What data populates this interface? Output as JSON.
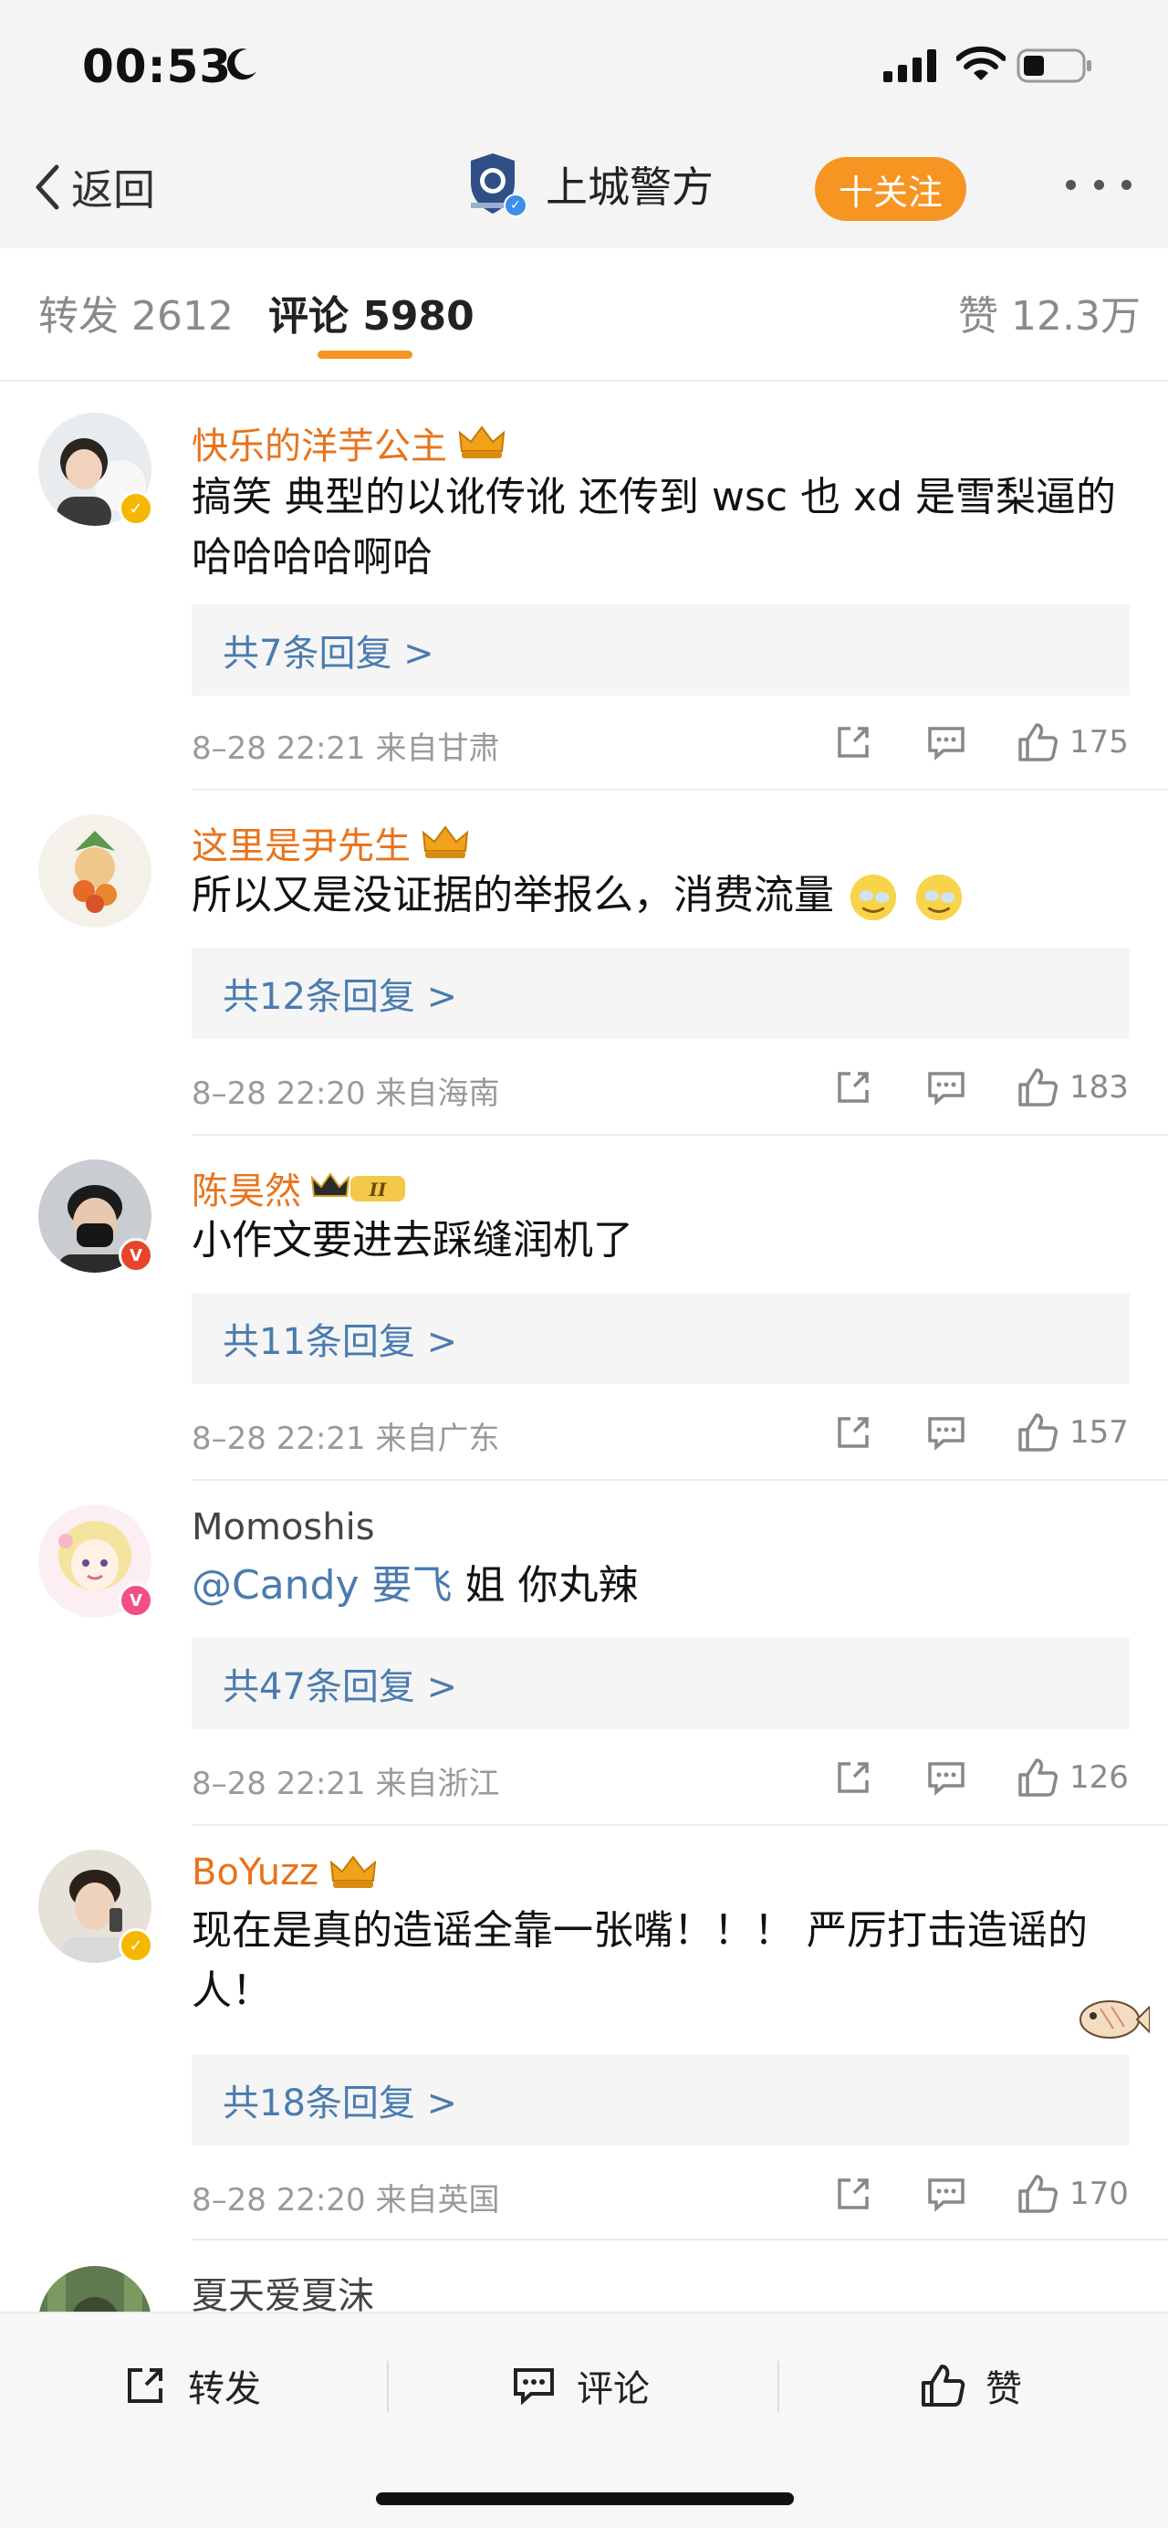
{
  "status": {
    "time": "00:53"
  },
  "nav": {
    "back_label": "返回",
    "account_name": "上城警方",
    "follow_label": "十关注"
  },
  "tabs": {
    "repost": "转发 2612",
    "comment": "评论 5980",
    "like": "赞 12.3万"
  },
  "comments": [
    {
      "name": "快乐的洋芋公主",
      "text_lines": [
        "搞笑 典型的以讹传讹 还传到 wsc 也 xd 是雪梨逼的",
        "哈哈哈哈啊哈"
      ],
      "replies": "共7条回复 >",
      "meta": "8–28 22:21 来自甘肃",
      "likes": "175"
    },
    {
      "name": "这里是尹先生",
      "text_lines": [
        "所以又是没证据的举报么，消费流量"
      ],
      "replies": "共12条回复 >",
      "meta": "8–28 22:20 来自海南",
      "likes": "183"
    },
    {
      "name": "陈昊然",
      "text_lines": [
        "小作文要进去踩缝润机了"
      ],
      "replies": "共11条回复 >",
      "meta": "8–28 22:21 来自广东",
      "likes": "157"
    },
    {
      "name": "Momoshis",
      "mention": "@Candy 要飞",
      "text_rest": " 姐 你丸辣",
      "replies": "共47条回复 >",
      "meta": "8–28 22:21 来自浙江",
      "likes": "126"
    },
    {
      "name": "BoYuzz",
      "text_lines": [
        "现在是真的造谣全靠一张嘴！！！ 严厉打击造谣的",
        "人！"
      ],
      "replies": "共18条回复 >",
      "meta": "8–28 22:20 来自英国",
      "likes": "170"
    },
    {
      "name": "夏天爱夏沫"
    }
  ],
  "bottom": {
    "repost": "转发",
    "comment": "评论",
    "like": "赞"
  },
  "colors": {
    "accent": "#f79522",
    "vip_name": "#e8731c",
    "link": "#4a7bb0"
  },
  "icons": {
    "status": [
      "moon-icon",
      "signal-icon",
      "wifi-icon",
      "battery-icon"
    ],
    "actions": [
      "share-icon",
      "comment-icon",
      "like-icon"
    ]
  }
}
